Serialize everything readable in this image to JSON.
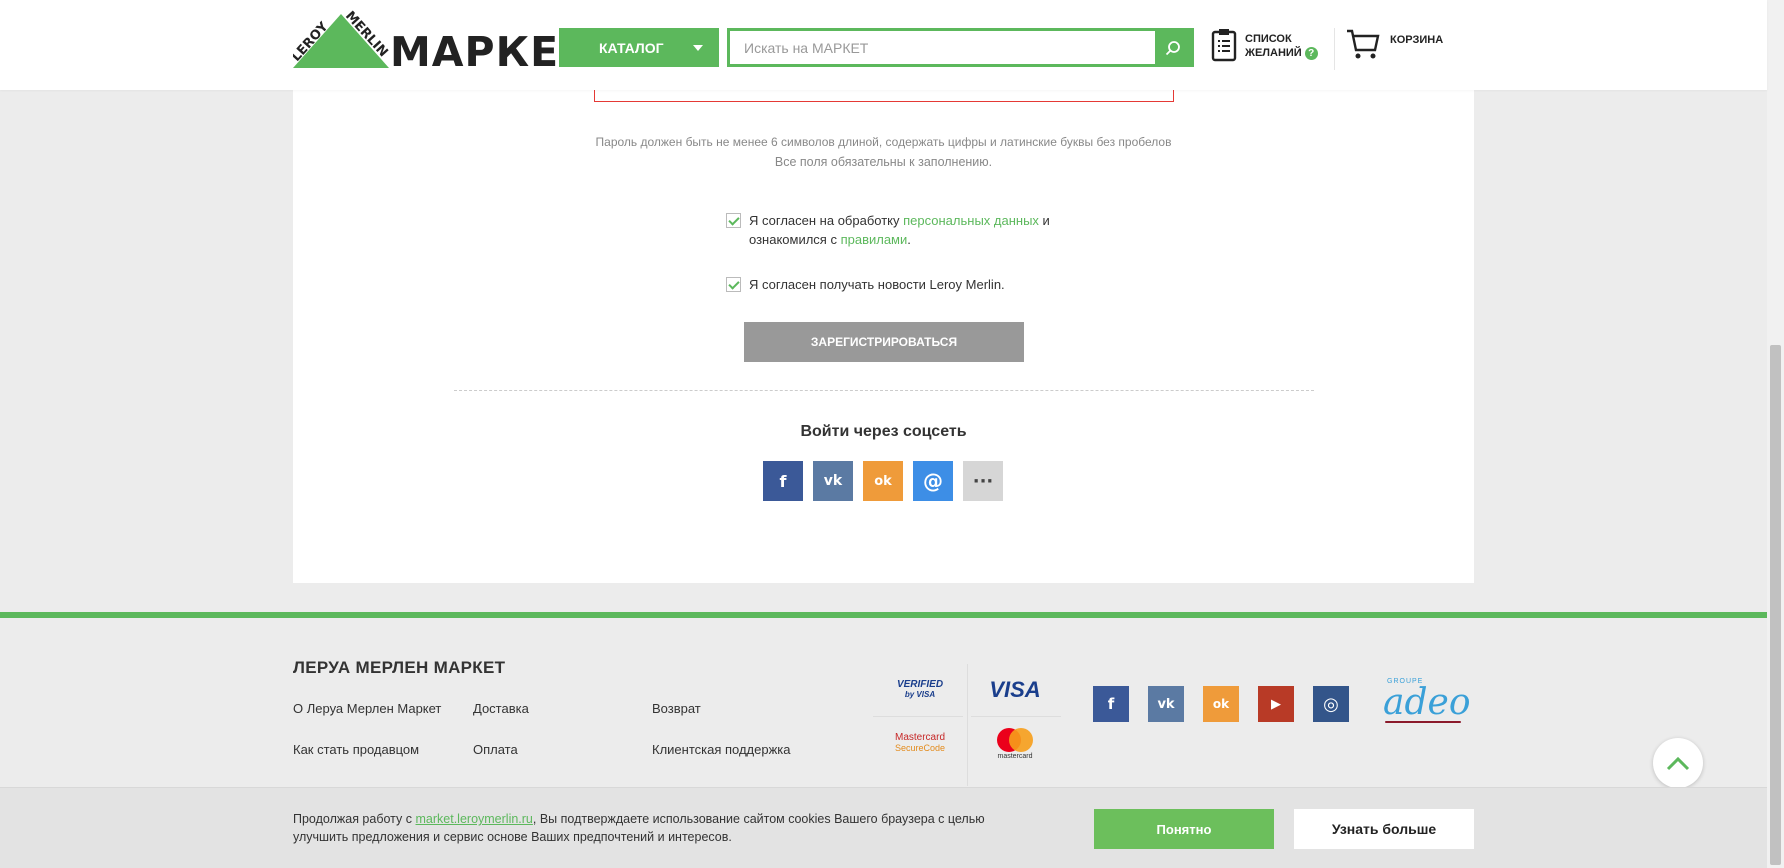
{
  "header": {
    "logo_brand": "LEROY MERLIN",
    "logo_word": "МАРКЕТ",
    "catalog_label": "КАТАЛОГ",
    "search_placeholder": "Искать на МАРКЕТ",
    "wishlist_line1": "СПИСОК",
    "wishlist_line2": "ЖЕЛАНИЙ",
    "wishlist_help": "?",
    "cart_label": "КОРЗИНА"
  },
  "form": {
    "password_hint": "Пароль должен быть не менее 6 символов длиной, содержать цифры и латинские буквы без пробелов",
    "required_note": "Все поля обязательны к заполнению.",
    "consent1_pre": "Я согласен на обработку ",
    "consent1_link1": "персональных данных",
    "consent1_mid": " и",
    "consent1_line2_pre": "ознакомился с ",
    "consent1_link2": "правилами",
    "consent1_end": ".",
    "consent2": "Я согласен получать новости Leroy Merlin.",
    "register_label": "ЗАРЕГИСТРИРОВАТЬСЯ",
    "social_title": "Войти через соцсеть",
    "social": [
      {
        "icon": "facebook-icon",
        "glyph": "f",
        "color": "#3b5998"
      },
      {
        "icon": "vk-icon",
        "glyph": "vk",
        "color": "#5b7aa3"
      },
      {
        "icon": "odnoklassniki-icon",
        "glyph": "ok",
        "color": "#ef9b3a"
      },
      {
        "icon": "mailru-icon",
        "glyph": "@",
        "color": "#3d8ee6"
      },
      {
        "icon": "more-icon",
        "glyph": "···",
        "color": "#d6d6d6"
      }
    ]
  },
  "footer": {
    "title": "ЛЕРУА МЕРЛЕН МАРКЕТ",
    "links_col1": [
      "О Леруа Мерлен Маркет",
      "Как стать продавцом"
    ],
    "links_col2": [
      "Доставка",
      "Оплата"
    ],
    "links_col3": [
      "Возврат",
      "Клиентская поддержка"
    ],
    "payments": {
      "verified_line1": "VERIFIED",
      "verified_line2": "by VISA",
      "visa": "VISA",
      "mc_secure_line1": "Mastercard",
      "mc_secure_line2": "SecureCode",
      "mastercard": "mastercard"
    },
    "social": [
      {
        "icon": "facebook-icon",
        "glyph": "f",
        "color": "#3b5998"
      },
      {
        "icon": "vk-icon",
        "glyph": "vk",
        "color": "#5b7aa3"
      },
      {
        "icon": "odnoklassniki-icon",
        "glyph": "ok",
        "color": "#ef9b3a"
      },
      {
        "icon": "youtube-icon",
        "glyph": "▶",
        "color": "#b83a26"
      },
      {
        "icon": "instagram-icon",
        "glyph": "◎",
        "color": "#33558a"
      }
    ],
    "adeo_small": "GROUPE",
    "adeo": "adeo"
  },
  "cookie": {
    "text_pre": "Продолжая работу с ",
    "text_link": "market.leroymerlin.ru",
    "text_post": ", Вы подтверждаете использование сайтом cookies Вашего браузера с целью улучшить предложения и сервис  основе Ваших предпочтений и интересов.",
    "ok_label": "Понятно",
    "more_label": "Узнать больше"
  },
  "colors": {
    "brand_green": "#5cb85c",
    "error_red": "#e53935"
  }
}
